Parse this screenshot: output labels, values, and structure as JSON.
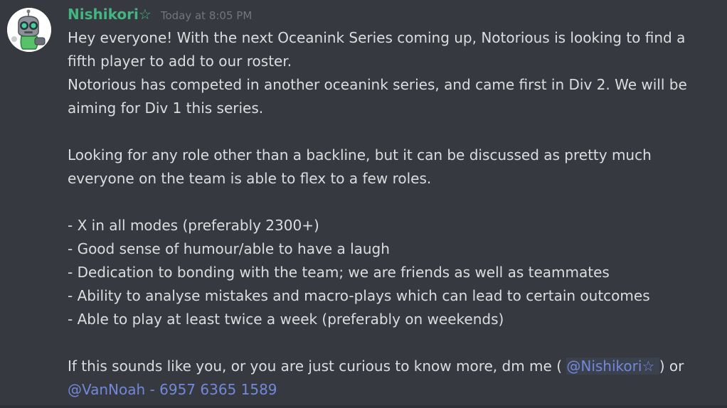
{
  "message": {
    "author": "Nishikori☆",
    "timestamp": "Today at 8:05 PM",
    "lines": [
      "Hey everyone! With the next Oceanink Series coming up, Notorious is looking to find a",
      "fifth player to add to our roster.",
      "Notorious has competed in another oceanink series, and came first in Div 2. We will be",
      "aiming for Div 1 this series.",
      "",
      "Looking for any role other than a backline, but it can be discussed as pretty much",
      "everyone on the team is able to flex to a few roles.",
      "",
      "- X in all modes (preferably 2300+)",
      "- Good sense of humour/able to have a laugh",
      "- Dedication to bonding with the team; we are friends as well as teammates",
      "- Ability to analyse mistakes and macro-plays which can lead to certain outcomes",
      "- Able to play at least twice a week (preferably on weekends)",
      ""
    ],
    "closing_text_before": "If this sounds like you, or you are just curious to know more, dm me ( ",
    "mention_user": "@Nishikori☆ ",
    "closing_text_after": " ) or",
    "mention_contact": "@VanNoah - 6957 6365 1589"
  },
  "colors": {
    "background": "#36393f",
    "username": "#43b581",
    "text": "#dcddde",
    "timestamp": "#72767d",
    "mention": "#7289da"
  },
  "icons": {
    "avatar": "robot-avatar-icon"
  }
}
